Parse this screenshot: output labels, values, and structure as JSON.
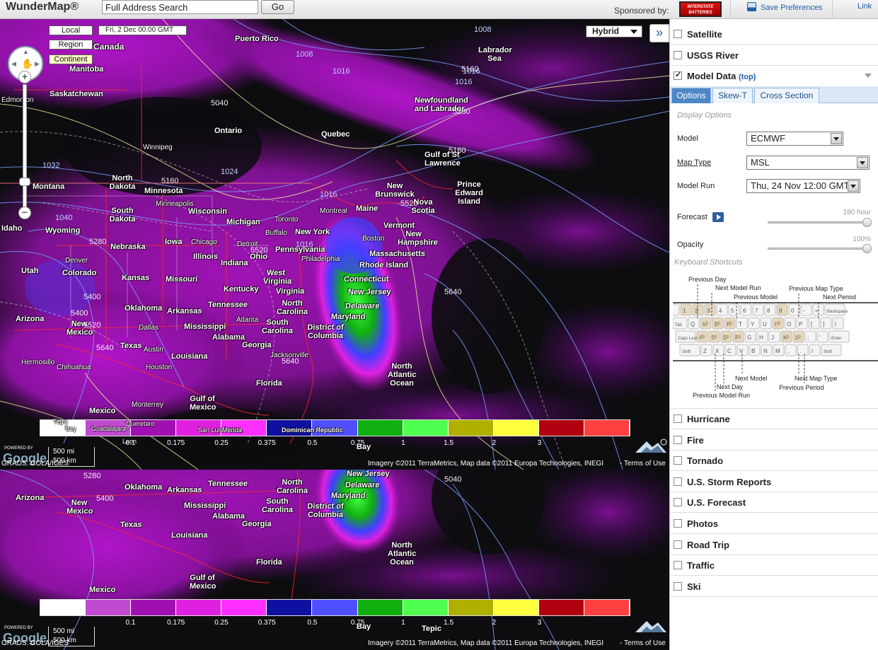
{
  "header": {
    "logo": "WunderMap®",
    "search_value": "Full Address Search",
    "go_label": "Go",
    "sponsored_by": "Sponsored by:",
    "sponsor_logo_text": "INTERSTATE BATTERIES",
    "save_preferences": "Save Preferences",
    "link": "Link"
  },
  "map": {
    "view_buttons": [
      "Local",
      "Region",
      "Continent"
    ],
    "active_view": "Continent",
    "date": "Fri, 2 Dec 00:00 GMT",
    "map_type": "Hybrid",
    "labels": [
      {
        "text": "Canada"
      },
      {
        "text": "Manitoba"
      },
      {
        "text": "Saskatchewan"
      },
      {
        "text": "Edmonton"
      },
      {
        "text": "Ontario"
      },
      {
        "text": "Quebec"
      },
      {
        "text": "Newfoundland and Labrador"
      },
      {
        "text": "Labrador Sea"
      },
      {
        "text": "Gulf of St Lawrence"
      },
      {
        "text": "New Brunswick"
      },
      {
        "text": "Nova Scotia"
      },
      {
        "text": "Prince Edward Island"
      },
      {
        "text": "Maine"
      },
      {
        "text": "Vermont"
      },
      {
        "text": "New Hampshire"
      },
      {
        "text": "Massachusetts"
      },
      {
        "text": "Rhode Island"
      },
      {
        "text": "Connecticut"
      },
      {
        "text": "New Jersey"
      },
      {
        "text": "Delaware"
      },
      {
        "text": "Maryland"
      },
      {
        "text": "District of Columbia"
      },
      {
        "text": "New York"
      },
      {
        "text": "Pennsylvania"
      },
      {
        "text": "Ohio"
      },
      {
        "text": "Michigan"
      },
      {
        "text": "Wisconsin"
      },
      {
        "text": "Minnesota"
      },
      {
        "text": "North Dakota"
      },
      {
        "text": "South Dakota"
      },
      {
        "text": "Montana"
      },
      {
        "text": "Wyoming"
      },
      {
        "text": "Idaho"
      },
      {
        "text": "Utah"
      },
      {
        "text": "Colorado"
      },
      {
        "text": "Nebraska"
      },
      {
        "text": "Iowa"
      },
      {
        "text": "Illinois"
      },
      {
        "text": "Indiana"
      },
      {
        "text": "Kansas"
      },
      {
        "text": "Missouri"
      },
      {
        "text": "Kentucky"
      },
      {
        "text": "West Virginia"
      },
      {
        "text": "Virginia"
      },
      {
        "text": "North Carolina"
      },
      {
        "text": "South Carolina"
      },
      {
        "text": "Tennessee"
      },
      {
        "text": "Oklahoma"
      },
      {
        "text": "Arkansas"
      },
      {
        "text": "Mississippi"
      },
      {
        "text": "Alabama"
      },
      {
        "text": "Georgia"
      },
      {
        "text": "Louisiana"
      },
      {
        "text": "Texas"
      },
      {
        "text": "Arizona"
      },
      {
        "text": "New Mexico"
      },
      {
        "text": "Florida"
      },
      {
        "text": "Gulf of Mexico"
      },
      {
        "text": "Mexico"
      },
      {
        "text": "North Atlantic Ocean"
      },
      {
        "text": "Chihuahua"
      },
      {
        "text": "Hermosillo"
      },
      {
        "text": "Monterrey"
      },
      {
        "text": "Houston"
      },
      {
        "text": "Dallas"
      },
      {
        "text": "Austin"
      },
      {
        "text": "Atlanta"
      },
      {
        "text": "Jacksonville"
      },
      {
        "text": "Toronto"
      },
      {
        "text": "Montreal"
      },
      {
        "text": "Boston"
      },
      {
        "text": "Philadelphia"
      },
      {
        "text": "Chicago"
      },
      {
        "text": "Denver"
      },
      {
        "text": "Winnipeg"
      },
      {
        "text": "Minneapolis"
      },
      {
        "text": "Detroit"
      },
      {
        "text": "Buffalo"
      },
      {
        "text": "Cuba"
      },
      {
        "text": "Dominican Republic"
      },
      {
        "text": "Puerto Rico"
      },
      {
        "text": "Bay"
      },
      {
        "text": "Tepic"
      },
      {
        "text": "Guadalajara"
      },
      {
        "text": "Leon"
      },
      {
        "text": "Queretaro"
      },
      {
        "text": "San Luis Potosi"
      },
      {
        "text": "Merida"
      },
      {
        "text": "Cancun"
      },
      {
        "text": "Veracruz"
      },
      {
        "text": "Morelia"
      },
      {
        "text": "Oaxaca"
      },
      {
        "text": "Tucson"
      },
      {
        "text": "Phoenix"
      },
      {
        "text": "El Paso"
      },
      {
        "text": "Albuquerque"
      },
      {
        "text": "Wichita"
      },
      {
        "text": "Tulsa"
      },
      {
        "text": "Memphis"
      },
      {
        "text": "Nashville"
      },
      {
        "text": "Raleigh"
      },
      {
        "text": "Charlotte"
      },
      {
        "text": "Columbia"
      },
      {
        "text": "Lexington"
      },
      {
        "text": "Louisville"
      },
      {
        "text": "Cincinnati"
      },
      {
        "text": "Columbus"
      },
      {
        "text": "Pittsburgh"
      },
      {
        "text": "Baltimore"
      },
      {
        "text": "Hartford"
      },
      {
        "text": "Quebec"
      },
      {
        "text": "Portland"
      },
      {
        "text": "Saint Louis"
      },
      {
        "text": "Kansas City"
      },
      {
        "text": "Des Moines"
      },
      {
        "text": "Omaha"
      },
      {
        "text": "Lincoln"
      },
      {
        "text": "Milwaukee"
      },
      {
        "text": "Salt Lake City"
      },
      {
        "text": "Billings"
      },
      {
        "text": "Regina"
      },
      {
        "text": "Saskatoon"
      },
      {
        "text": "Calgary"
      },
      {
        "text": "Torreon"
      },
      {
        "text": "Durango"
      },
      {
        "text": "Saltillo"
      },
      {
        "text": "Matamoros"
      },
      {
        "text": "Nuevo Laredo"
      },
      {
        "text": "Corpus Christi"
      },
      {
        "text": "Victoria"
      },
      {
        "text": "Tampico"
      },
      {
        "text": "Culiacan"
      },
      {
        "text": "Mazatlan"
      },
      {
        "text": "Obregon"
      },
      {
        "text": "Ciudad Juarez"
      },
      {
        "text": "San Antonio"
      },
      {
        "text": "New Orleans"
      },
      {
        "text": "Mobile"
      },
      {
        "text": "Tallahassee"
      },
      {
        "text": "Orlando"
      },
      {
        "text": "Tampa"
      },
      {
        "text": "Miami"
      },
      {
        "text": "Birmingham"
      },
      {
        "text": "Shreveport"
      },
      {
        "text": "Jackson"
      },
      {
        "text": "Little Rock"
      },
      {
        "text": "Knoxville"
      },
      {
        "text": "Savannah"
      },
      {
        "text": "Charleston"
      },
      {
        "text": "Norfolk"
      },
      {
        "text": "Richmond"
      },
      {
        "text": "Washington"
      }
    ],
    "isobars": [
      "1008",
      "1008",
      "1016",
      "1016",
      "1016",
      "1016",
      "1024",
      "1032",
      "1040",
      "1016"
    ],
    "heights": [
      "5160",
      "5280",
      "5040",
      "5160",
      "5280",
      "5400",
      "5520",
      "5640",
      "5400",
      "5520",
      "5640",
      "5280",
      "5400",
      "5520",
      "5640",
      "5160",
      "5040"
    ],
    "legend_ticks": [
      "0.1",
      "0.175",
      "0.25",
      "0.375",
      "0.5",
      "0.75",
      "1",
      "1.5",
      "2",
      "3"
    ],
    "legend_colors": [
      "#ffffff",
      "#c04ad0",
      "#a010b0",
      "#e020e0",
      "#ff30ff",
      "#1010a0",
      "#4f4fff",
      "#10b010",
      "#50ff50",
      "#b0b000",
      "#ffff40",
      "#b00010",
      "#ff4040"
    ],
    "scale_mi": "500 mi",
    "scale_km": "500 km",
    "powered_by": "POWERED BY",
    "google": "Google",
    "grads": "GRADS: COLA/IGES",
    "attribution": "Imagery ©2011 TerraMetrics, Map data ©2011 Europa Technologies, INEGI",
    "terms": "- Terms of Use",
    "expand": "»"
  },
  "sidebar": {
    "layers_top": [
      {
        "label": "Satellite",
        "checked": false
      },
      {
        "label": "USGS River",
        "checked": false
      },
      {
        "label": "Model Data",
        "checked": true,
        "top_link": "(top)"
      }
    ],
    "tabs": [
      "Options",
      "Skew-T",
      "Cross Section"
    ],
    "active_tab": "Options",
    "display_options": "Display Options",
    "model_label": "Model",
    "model_value": "ECMWF",
    "map_type_label": "Map Type",
    "map_type_value": "MSL",
    "model_run_label": "Model Run",
    "model_run_value": "Thu, 24 Nov 12:00 GMT",
    "forecast_label": "Forecast",
    "forecast_value": "180 hour",
    "forecast_fraction": 1.0,
    "opacity_label": "Opacity",
    "opacity_value": "100%",
    "opacity_fraction": 1.0,
    "keyboard_shortcuts": "Keyboard Shortcuts",
    "kbd_labels": [
      "Previous Day",
      "Next Model Run",
      "Previous Model",
      "Previous Map Type",
      "Next Period",
      "Next Model",
      "Next Day",
      "Previous Model Run",
      "Next Map Type",
      "Previous Period"
    ],
    "kbd_row1": [
      "`",
      "1",
      "2",
      "3",
      "4",
      "5",
      "6",
      "7",
      "8",
      "9",
      "0",
      "-",
      "=",
      "Backspace"
    ],
    "kbd_row2": [
      "Tab",
      "Q",
      "W",
      "E",
      "R",
      "T",
      "Y",
      "U",
      "I",
      "O",
      "P",
      "[",
      "]",
      "\\"
    ],
    "kbd_row3": [
      "Caps Lock",
      "A",
      "S",
      "D",
      "F",
      "G",
      "H",
      "J",
      "K",
      "L",
      ";",
      "'",
      "Enter"
    ],
    "kbd_row4": [
      "Shift",
      "Z",
      "X",
      "C",
      "V",
      "B",
      "N",
      "M",
      ",",
      ".",
      "/",
      "Shift"
    ],
    "layers_bottom": [
      {
        "label": "Hurricane",
        "checked": false
      },
      {
        "label": "Fire",
        "checked": false
      },
      {
        "label": "Tornado",
        "checked": false
      },
      {
        "label": "U.S. Storm Reports",
        "checked": false
      },
      {
        "label": "U.S. Forecast",
        "checked": false
      },
      {
        "label": "Photos",
        "checked": false
      },
      {
        "label": "Road Trip",
        "checked": false
      },
      {
        "label": "Traffic",
        "checked": false
      },
      {
        "label": "Ski",
        "checked": false
      }
    ]
  }
}
